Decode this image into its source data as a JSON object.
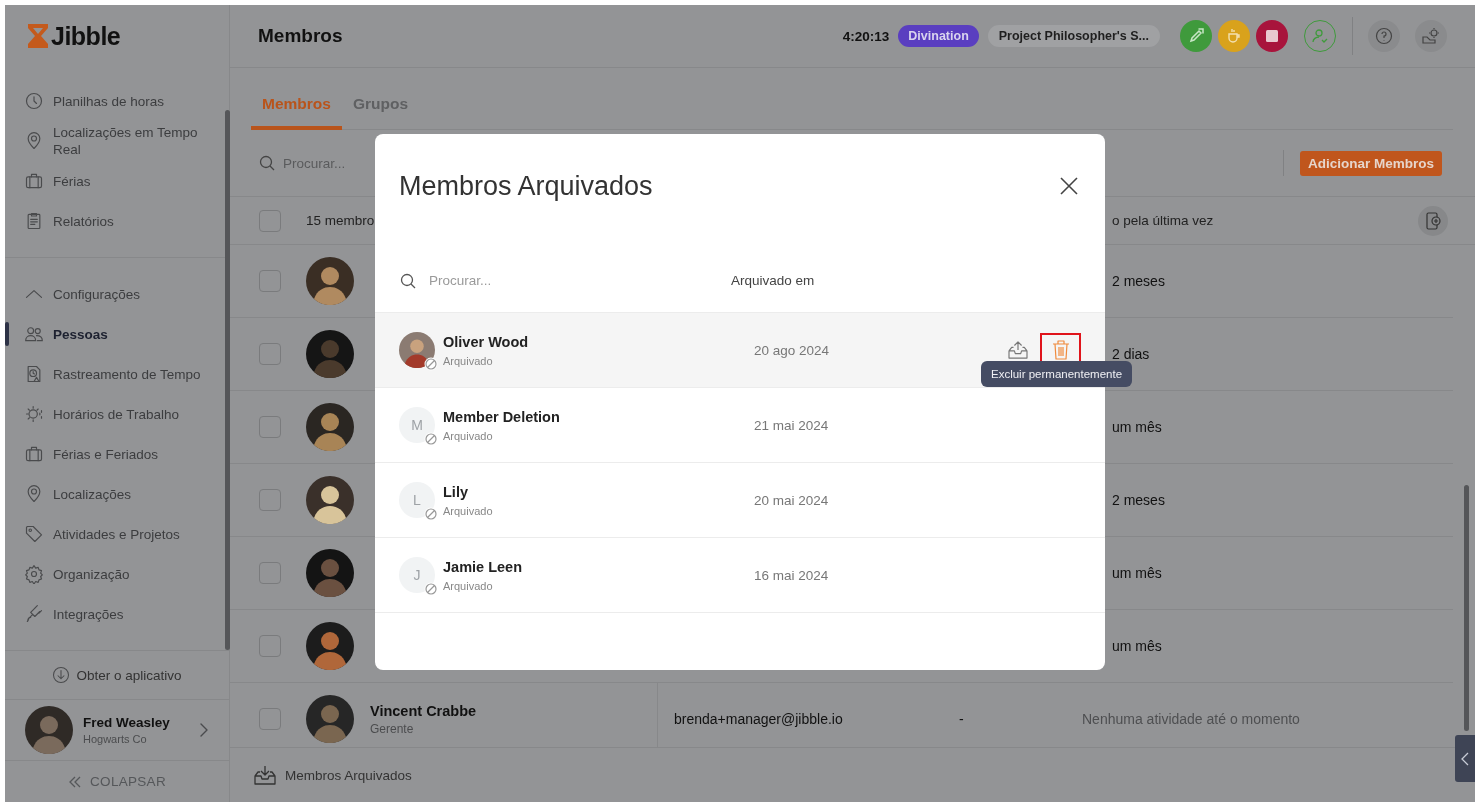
{
  "sidebar": {
    "logo": "Jibble",
    "items": [
      {
        "label": "Planilhas de horas",
        "selected": false
      },
      {
        "label": "Localizações em Tempo Real",
        "selected": false
      },
      {
        "label": "Férias",
        "selected": false
      },
      {
        "label": "Relatórios",
        "selected": false
      }
    ],
    "section": {
      "label": "Configurações",
      "expanded": true,
      "items": [
        {
          "label": "Pessoas",
          "selected": true
        },
        {
          "label": "Rastreamento de Tempo",
          "selected": false
        },
        {
          "label": "Horários de Trabalho",
          "selected": false
        },
        {
          "label": "Férias e Feriados",
          "selected": false
        },
        {
          "label": "Localizações",
          "selected": false
        },
        {
          "label": "Atividades e Projetos",
          "selected": false
        },
        {
          "label": "Organização",
          "selected": false
        },
        {
          "label": "Integrações",
          "selected": false
        }
      ]
    },
    "get_app": "Obter o aplicativo",
    "user": {
      "name": "Fred Weasley",
      "org": "Hogwarts Co"
    },
    "collapse": "COLAPSAR"
  },
  "header": {
    "title": "Membros",
    "timer": "4:20:13",
    "activity": "Divination",
    "project": "Project Philosopher's S..."
  },
  "tabs": [
    {
      "label": "Membros",
      "selected": true
    },
    {
      "label": "Grupos",
      "selected": false
    }
  ],
  "toolbar": {
    "search_placeholder": "Procurar...",
    "add_button": "Adicionar Membros"
  },
  "table": {
    "select_all_checked": false,
    "columns": [
      "15 membro",
      "o pela última vez"
    ],
    "rows": [
      {
        "checked": false,
        "activity": "2 meses",
        "cut": true
      },
      {
        "checked": false,
        "activity": "2 dias",
        "cut": true
      },
      {
        "checked": false,
        "activity": "um mês",
        "cut": true
      },
      {
        "checked": false,
        "activity": "2 meses",
        "cut": true
      },
      {
        "checked": false,
        "activity": "um mês",
        "cut": true
      },
      {
        "checked": false,
        "activity": "um mês",
        "cut": true
      },
      {
        "checked": false,
        "name": "Vincent Crabbe",
        "role": "Gerente",
        "email": "brenda+manager@jibble.io",
        "column_4": "-",
        "activity": "Nenhuma atividade até o momento",
        "cut": false
      }
    ]
  },
  "footer": {
    "archived_link": "Membros Arquivados"
  },
  "modal": {
    "title": "Membros Arquivados",
    "search_placeholder": "Procurar...",
    "date_column": "Arquivado em",
    "tooltip": "Excluir permanentemente",
    "delete_highlighted": true,
    "rows": [
      {
        "kind": "photo",
        "name": "Oliver Wood",
        "status": "Arquivado",
        "date": "20 ago 2024",
        "hovered": true
      },
      {
        "kind": "initial",
        "initial": "M",
        "name": "Member Deletion",
        "status": "Arquivado",
        "date": "21 mai 2024",
        "hovered": false
      },
      {
        "kind": "initial",
        "initial": "L",
        "name": "Lily",
        "status": "Arquivado",
        "date": "20 mai 2024",
        "hovered": false
      },
      {
        "kind": "initial",
        "initial": "J",
        "name": "Jamie Leen",
        "status": "Arquivado",
        "date": "16 mai 2024",
        "hovered": false
      }
    ]
  }
}
